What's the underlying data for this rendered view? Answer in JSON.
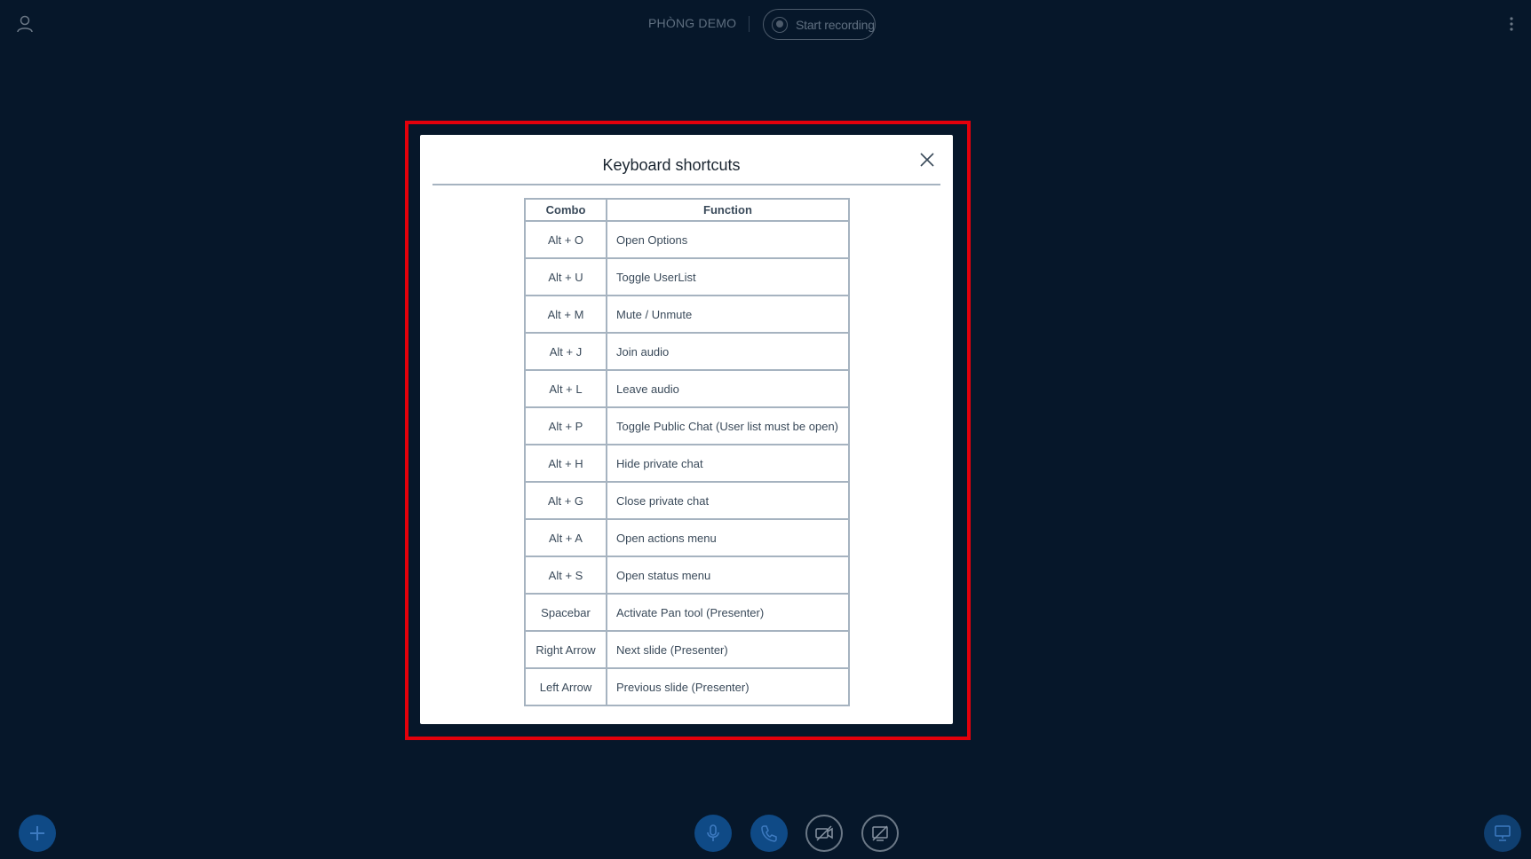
{
  "header": {
    "room_name": "PHÒNG DEMO",
    "record_label": "Start recording"
  },
  "modal": {
    "title": "Keyboard shortcuts",
    "columns": [
      "Combo",
      "Function"
    ],
    "rows": [
      {
        "combo": "Alt + O",
        "function": "Open Options"
      },
      {
        "combo": "Alt + U",
        "function": "Toggle UserList"
      },
      {
        "combo": "Alt + M",
        "function": "Mute / Unmute"
      },
      {
        "combo": "Alt + J",
        "function": "Join audio"
      },
      {
        "combo": "Alt + L",
        "function": "Leave audio"
      },
      {
        "combo": "Alt + P",
        "function": "Toggle Public Chat (User list must be open)"
      },
      {
        "combo": "Alt + H",
        "function": "Hide private chat"
      },
      {
        "combo": "Alt + G",
        "function": "Close private chat"
      },
      {
        "combo": "Alt + A",
        "function": "Open actions menu"
      },
      {
        "combo": "Alt + S",
        "function": "Open status menu"
      },
      {
        "combo": "Spacebar",
        "function": "Activate Pan tool (Presenter)"
      },
      {
        "combo": "Right Arrow",
        "function": "Next slide (Presenter)"
      },
      {
        "combo": "Left Arrow",
        "function": "Previous slide (Presenter)"
      }
    ]
  },
  "icons": {
    "user": "user-icon",
    "more": "more-vertical-icon",
    "record": "record-icon",
    "close": "close-icon",
    "plus": "plus-icon",
    "microphone": "microphone-icon",
    "phone": "phone-icon",
    "camera_off": "camera-off-icon",
    "screenshare_off": "screenshare-off-icon",
    "presentation": "presentation-icon"
  },
  "colors": {
    "background": "#06172a",
    "highlight": "#e3000b",
    "accent": "#0f4a86",
    "table_border": "#a6b3c0"
  }
}
